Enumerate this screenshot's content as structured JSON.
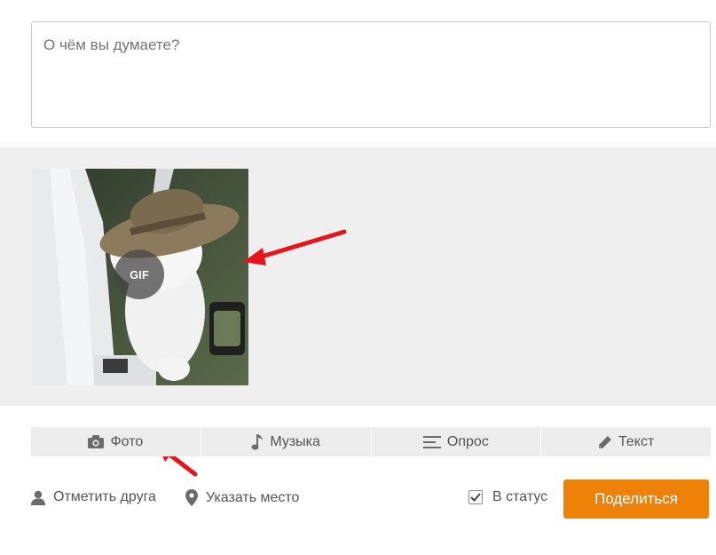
{
  "composer": {
    "placeholder": "О чём вы думаете?",
    "value": ""
  },
  "attachment": {
    "badge": "GIF"
  },
  "tabs": [
    {
      "label": "Фото",
      "icon": "camera-icon"
    },
    {
      "label": "Музыка",
      "icon": "music-note-icon"
    },
    {
      "label": "Опрос",
      "icon": "poll-lines-icon"
    },
    {
      "label": "Текст",
      "icon": "pencil-icon"
    }
  ],
  "actions": {
    "tag_friend": "Отметить друга",
    "location": "Указать место",
    "status_label": "В статус",
    "status_checked": true,
    "share_label": "Поделиться"
  },
  "colors": {
    "accent": "#ee8208",
    "annotation_arrow": "#e8141c",
    "panel_bg": "#efefef",
    "tab_bg": "#ededed"
  }
}
